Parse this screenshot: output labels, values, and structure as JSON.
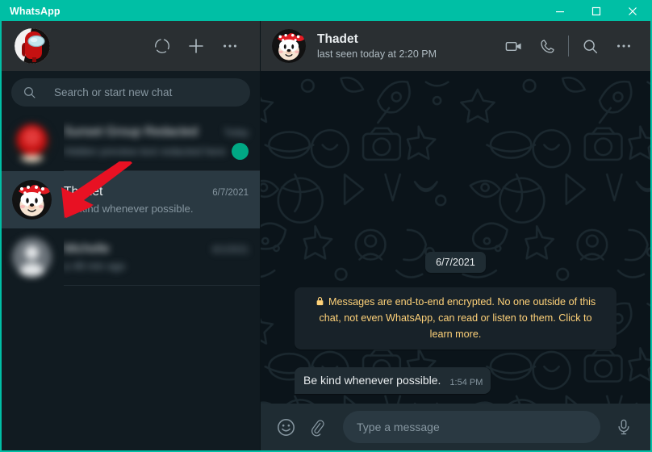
{
  "window": {
    "title": "WhatsApp",
    "accent_color": "#00bfa5",
    "controls": [
      {
        "name": "minimize",
        "glyph": "minimize"
      },
      {
        "name": "maximize",
        "glyph": "maximize"
      },
      {
        "name": "close",
        "glyph": "close"
      }
    ]
  },
  "sidebar": {
    "toolbar": {
      "profile_avatar_alt": "among-us-red-crewmate",
      "status_label": "Status",
      "new_chat_label": "New chat",
      "menu_label": "Menu"
    },
    "search": {
      "placeholder": "Search or start new chat",
      "value": "",
      "icon": "search-icon"
    },
    "chats": [
      {
        "name": "Sunset Group Redacted",
        "time": "Today",
        "message": "Hidden preview text redacted here",
        "blurred": true,
        "selected": false,
        "unread_badge": true,
        "avatar": "red-blurred"
      },
      {
        "name": "Thadet",
        "time": "6/7/2021",
        "message": "Be kind whenever possible.",
        "blurred": false,
        "selected": true,
        "unread_badge": false,
        "avatar": "minnie-mouse"
      },
      {
        "name": "Michelle",
        "time": "6/1/2021",
        "message": "a 48 min ago",
        "blurred": true,
        "selected": false,
        "unread_badge": false,
        "avatar": "default-person"
      }
    ],
    "annotation": {
      "type": "arrow",
      "color": "#e81123",
      "points_to": "thadet-chat-avatar"
    }
  },
  "chat": {
    "header": {
      "contact_name": "Thadet",
      "status": "last seen today at 2:20 PM",
      "avatar_alt": "minnie-mouse",
      "actions": [
        {
          "name": "video-call",
          "label": "Video call"
        },
        {
          "name": "voice-call",
          "label": "Voice call"
        },
        {
          "name": "search",
          "label": "Search"
        },
        {
          "name": "menu",
          "label": "Menu"
        }
      ]
    },
    "date_divider": "6/7/2021",
    "encryption_notice": {
      "lock": "🔒",
      "text": "Messages are end-to-end encrypted. No one outside of this chat, not even WhatsApp, can read or listen to them. Click to learn more.",
      "color": "#ffd279"
    },
    "messages": [
      {
        "direction": "incoming",
        "text": "Be kind whenever possible.",
        "time": "1:54 PM"
      }
    ],
    "composer": {
      "emoji_label": "Emoji",
      "attach_label": "Attach",
      "placeholder": "Type a message",
      "value": "",
      "mic_label": "Voice message"
    }
  }
}
